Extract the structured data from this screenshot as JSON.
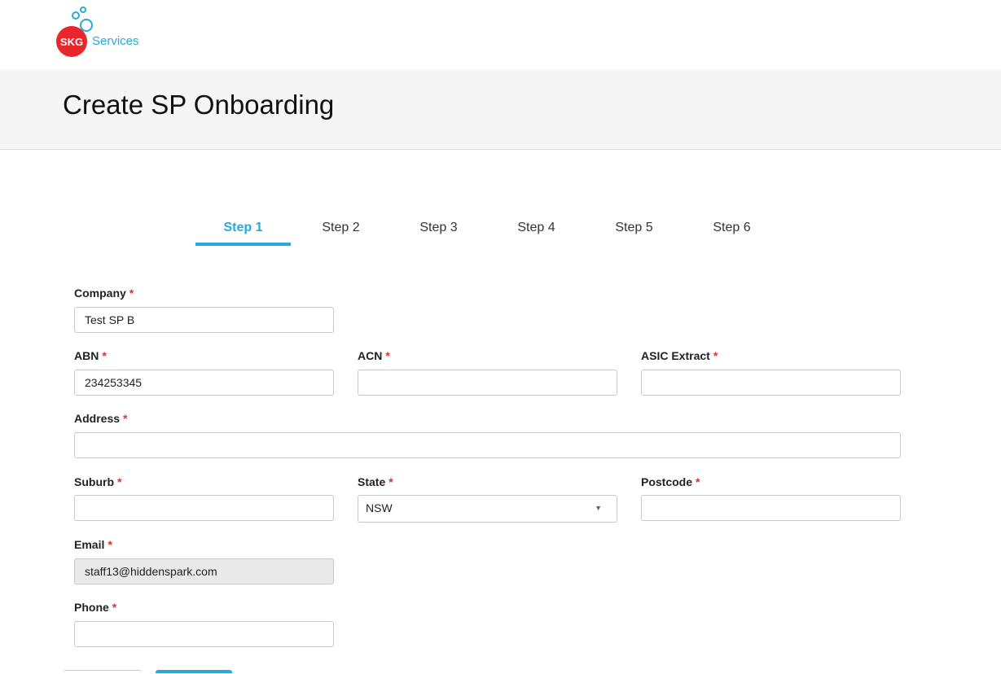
{
  "logo": {
    "badge_text": "SKG",
    "brand_text": "Services",
    "colors": {
      "red": "#e8262b",
      "blue": "#2aa8dc"
    }
  },
  "header": {
    "title": "Create SP Onboarding"
  },
  "steps": [
    {
      "label": "Step 1",
      "active": true
    },
    {
      "label": "Step 2",
      "active": false
    },
    {
      "label": "Step 3",
      "active": false
    },
    {
      "label": "Step 4",
      "active": false
    },
    {
      "label": "Step 5",
      "active": false
    },
    {
      "label": "Step 6",
      "active": false
    }
  ],
  "form": {
    "company": {
      "label": "Company",
      "required_mark": "*",
      "value": "Test SP B"
    },
    "abn": {
      "label": "ABN",
      "required_mark": "*",
      "value": "234253345"
    },
    "acn": {
      "label": "ACN",
      "required_mark": "*",
      "value": ""
    },
    "asic": {
      "label": "ASIC Extract",
      "required_mark": "*",
      "value": ""
    },
    "address": {
      "label": "Address",
      "required_mark": "*",
      "value": ""
    },
    "suburb": {
      "label": "Suburb",
      "required_mark": "*",
      "value": ""
    },
    "state": {
      "label": "State",
      "required_mark": "*",
      "value": "NSW"
    },
    "postcode": {
      "label": "Postcode",
      "required_mark": "*",
      "value": ""
    },
    "email": {
      "label": "Email",
      "required_mark": "*",
      "value": "staff13@hiddenspark.com"
    },
    "phone": {
      "label": "Phone",
      "required_mark": "*",
      "value": ""
    }
  },
  "theme": {
    "accent": "#2aa8dc",
    "required": "#e03030"
  }
}
